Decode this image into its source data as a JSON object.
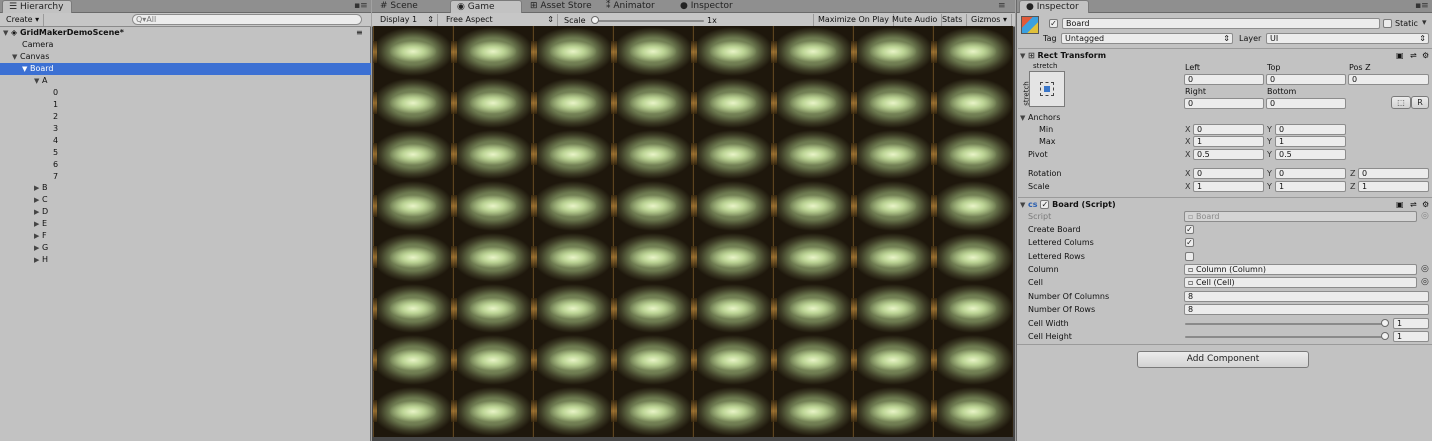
{
  "hierarchy": {
    "tab": "Hierarchy",
    "create_label": "Create",
    "search_placeholder": "Q▾All",
    "scene": "GridMakerDemoScene*",
    "items": [
      {
        "label": "Camera"
      },
      {
        "label": "Canvas"
      },
      {
        "label": "Board"
      },
      {
        "label": "A"
      },
      {
        "label": "0"
      },
      {
        "label": "1"
      },
      {
        "label": "2"
      },
      {
        "label": "3"
      },
      {
        "label": "4"
      },
      {
        "label": "5"
      },
      {
        "label": "6"
      },
      {
        "label": "7"
      },
      {
        "label": "B"
      },
      {
        "label": "C"
      },
      {
        "label": "D"
      },
      {
        "label": "E"
      },
      {
        "label": "F"
      },
      {
        "label": "G"
      },
      {
        "label": "H"
      }
    ]
  },
  "center_tabs": {
    "scene": "Scene",
    "game": "Game",
    "asset_store": "Asset Store",
    "animator": "Animator",
    "inspector": "Inspector"
  },
  "game_toolbar": {
    "display": "Display 1",
    "aspect": "Free Aspect",
    "scale_label": "Scale",
    "scale_value": "1x",
    "maximize": "Maximize On Play",
    "mute": "Mute Audio",
    "stats": "Stats",
    "gizmos": "Gizmos"
  },
  "inspector": {
    "tab": "Inspector",
    "object_name": "Board",
    "static_label": "Static",
    "tag_label": "Tag",
    "tag_value": "Untagged",
    "layer_label": "Layer",
    "layer_value": "UI",
    "rect_transform": {
      "title": "Rect Transform",
      "anchor_preset": "stretch",
      "anchor_preset_side": "stretch",
      "left_label": "Left",
      "left": "0",
      "top_label": "Top",
      "top": "0",
      "posz_label": "Pos Z",
      "posz": "0",
      "right_label": "Right",
      "right": "0",
      "bottom_label": "Bottom",
      "bottom": "0",
      "r_button": "R",
      "anchors_label": "Anchors",
      "min_label": "Min",
      "min_x": "0",
      "min_y": "0",
      "max_label": "Max",
      "max_x": "1",
      "max_y": "1",
      "pivot_label": "Pivot",
      "pivot_x": "0.5",
      "pivot_y": "0.5",
      "rotation_label": "Rotation",
      "rot_x": "0",
      "rot_y": "0",
      "rot_z": "0",
      "scale_label": "Scale",
      "scale_x": "1",
      "scale_y": "1",
      "scale_z": "1",
      "x": "X",
      "y": "Y",
      "z": "Z"
    },
    "board_script": {
      "title": "Board (Script)",
      "script_label": "Script",
      "script_value": "Board",
      "create_board_label": "Create Board",
      "create_board": true,
      "lettered_colums_label": "Lettered Colums",
      "lettered_colums": true,
      "lettered_rows_label": "Lettered Rows",
      "lettered_rows": false,
      "column_label": "Column",
      "column_value": "Column (Column)",
      "cell_label": "Cell",
      "cell_value": "Cell (Cell)",
      "num_columns_label": "Number Of Columns",
      "num_columns": "8",
      "num_rows_label": "Number Of Rows",
      "num_rows": "8",
      "cell_width_label": "Cell Width",
      "cell_width": "1",
      "cell_height_label": "Cell Height",
      "cell_height": "1"
    },
    "add_component": "Add Component"
  },
  "board": {
    "columns": 8,
    "rows": 8
  }
}
